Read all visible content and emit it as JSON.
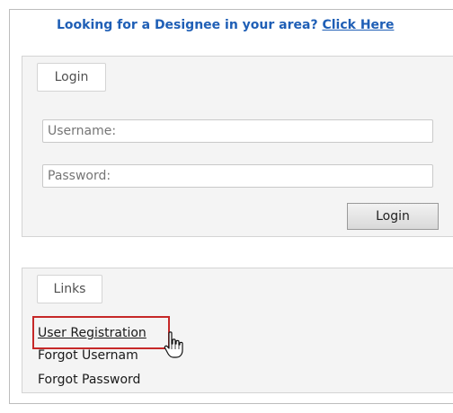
{
  "promo": {
    "text": "Looking for a Designee in your area? ",
    "link": "Click Here"
  },
  "login": {
    "legend": "Login",
    "username_placeholder": "Username:",
    "password_placeholder": "Password:",
    "button_label": "Login"
  },
  "links": {
    "legend": "Links",
    "items": [
      "User Registration",
      "Forgot Usernam",
      "Forgot Password"
    ]
  },
  "colors": {
    "link_blue": "#1f5fb6",
    "highlight_red": "#c62828"
  },
  "icons": {
    "cursor": "hand-pointer-icon"
  }
}
